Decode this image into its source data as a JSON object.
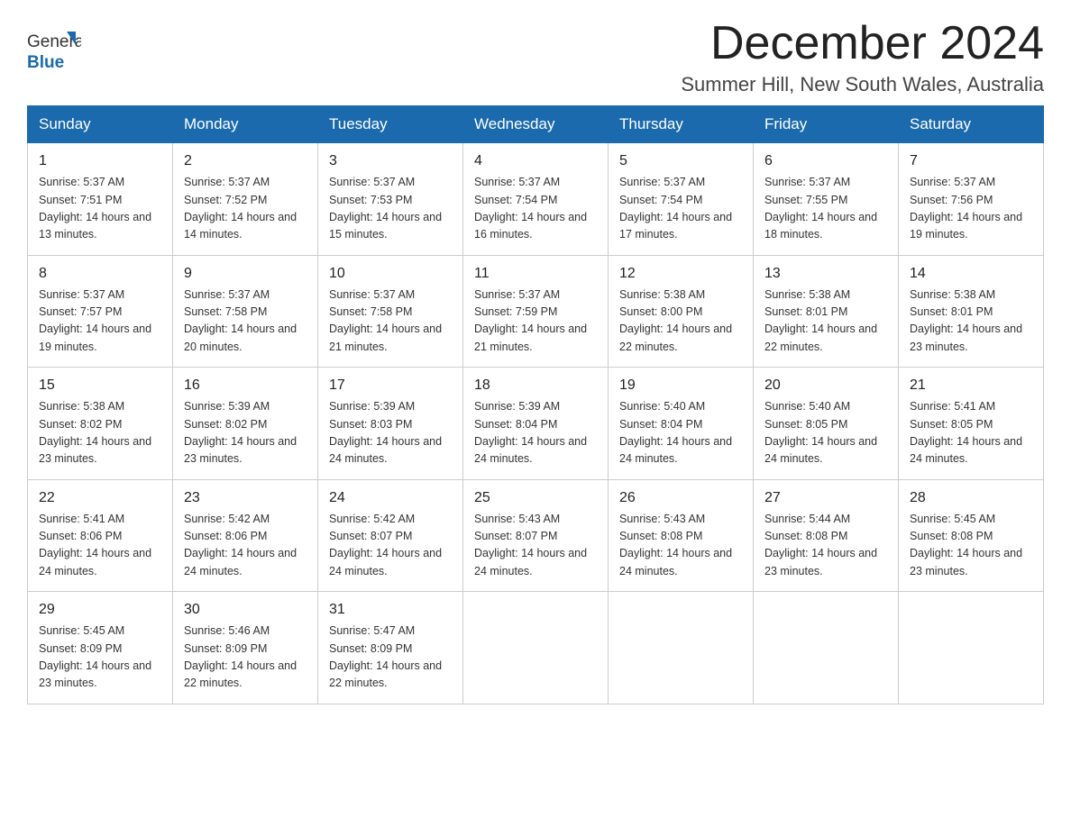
{
  "header": {
    "title": "December 2024",
    "location": "Summer Hill, New South Wales, Australia",
    "logo_general": "General",
    "logo_blue": "Blue"
  },
  "days_of_week": [
    "Sunday",
    "Monday",
    "Tuesday",
    "Wednesday",
    "Thursday",
    "Friday",
    "Saturday"
  ],
  "weeks": [
    [
      {
        "day": "1",
        "sunrise": "Sunrise: 5:37 AM",
        "sunset": "Sunset: 7:51 PM",
        "daylight": "Daylight: 14 hours and 13 minutes."
      },
      {
        "day": "2",
        "sunrise": "Sunrise: 5:37 AM",
        "sunset": "Sunset: 7:52 PM",
        "daylight": "Daylight: 14 hours and 14 minutes."
      },
      {
        "day": "3",
        "sunrise": "Sunrise: 5:37 AM",
        "sunset": "Sunset: 7:53 PM",
        "daylight": "Daylight: 14 hours and 15 minutes."
      },
      {
        "day": "4",
        "sunrise": "Sunrise: 5:37 AM",
        "sunset": "Sunset: 7:54 PM",
        "daylight": "Daylight: 14 hours and 16 minutes."
      },
      {
        "day": "5",
        "sunrise": "Sunrise: 5:37 AM",
        "sunset": "Sunset: 7:54 PM",
        "daylight": "Daylight: 14 hours and 17 minutes."
      },
      {
        "day": "6",
        "sunrise": "Sunrise: 5:37 AM",
        "sunset": "Sunset: 7:55 PM",
        "daylight": "Daylight: 14 hours and 18 minutes."
      },
      {
        "day": "7",
        "sunrise": "Sunrise: 5:37 AM",
        "sunset": "Sunset: 7:56 PM",
        "daylight": "Daylight: 14 hours and 19 minutes."
      }
    ],
    [
      {
        "day": "8",
        "sunrise": "Sunrise: 5:37 AM",
        "sunset": "Sunset: 7:57 PM",
        "daylight": "Daylight: 14 hours and 19 minutes."
      },
      {
        "day": "9",
        "sunrise": "Sunrise: 5:37 AM",
        "sunset": "Sunset: 7:58 PM",
        "daylight": "Daylight: 14 hours and 20 minutes."
      },
      {
        "day": "10",
        "sunrise": "Sunrise: 5:37 AM",
        "sunset": "Sunset: 7:58 PM",
        "daylight": "Daylight: 14 hours and 21 minutes."
      },
      {
        "day": "11",
        "sunrise": "Sunrise: 5:37 AM",
        "sunset": "Sunset: 7:59 PM",
        "daylight": "Daylight: 14 hours and 21 minutes."
      },
      {
        "day": "12",
        "sunrise": "Sunrise: 5:38 AM",
        "sunset": "Sunset: 8:00 PM",
        "daylight": "Daylight: 14 hours and 22 minutes."
      },
      {
        "day": "13",
        "sunrise": "Sunrise: 5:38 AM",
        "sunset": "Sunset: 8:01 PM",
        "daylight": "Daylight: 14 hours and 22 minutes."
      },
      {
        "day": "14",
        "sunrise": "Sunrise: 5:38 AM",
        "sunset": "Sunset: 8:01 PM",
        "daylight": "Daylight: 14 hours and 23 minutes."
      }
    ],
    [
      {
        "day": "15",
        "sunrise": "Sunrise: 5:38 AM",
        "sunset": "Sunset: 8:02 PM",
        "daylight": "Daylight: 14 hours and 23 minutes."
      },
      {
        "day": "16",
        "sunrise": "Sunrise: 5:39 AM",
        "sunset": "Sunset: 8:02 PM",
        "daylight": "Daylight: 14 hours and 23 minutes."
      },
      {
        "day": "17",
        "sunrise": "Sunrise: 5:39 AM",
        "sunset": "Sunset: 8:03 PM",
        "daylight": "Daylight: 14 hours and 24 minutes."
      },
      {
        "day": "18",
        "sunrise": "Sunrise: 5:39 AM",
        "sunset": "Sunset: 8:04 PM",
        "daylight": "Daylight: 14 hours and 24 minutes."
      },
      {
        "day": "19",
        "sunrise": "Sunrise: 5:40 AM",
        "sunset": "Sunset: 8:04 PM",
        "daylight": "Daylight: 14 hours and 24 minutes."
      },
      {
        "day": "20",
        "sunrise": "Sunrise: 5:40 AM",
        "sunset": "Sunset: 8:05 PM",
        "daylight": "Daylight: 14 hours and 24 minutes."
      },
      {
        "day": "21",
        "sunrise": "Sunrise: 5:41 AM",
        "sunset": "Sunset: 8:05 PM",
        "daylight": "Daylight: 14 hours and 24 minutes."
      }
    ],
    [
      {
        "day": "22",
        "sunrise": "Sunrise: 5:41 AM",
        "sunset": "Sunset: 8:06 PM",
        "daylight": "Daylight: 14 hours and 24 minutes."
      },
      {
        "day": "23",
        "sunrise": "Sunrise: 5:42 AM",
        "sunset": "Sunset: 8:06 PM",
        "daylight": "Daylight: 14 hours and 24 minutes."
      },
      {
        "day": "24",
        "sunrise": "Sunrise: 5:42 AM",
        "sunset": "Sunset: 8:07 PM",
        "daylight": "Daylight: 14 hours and 24 minutes."
      },
      {
        "day": "25",
        "sunrise": "Sunrise: 5:43 AM",
        "sunset": "Sunset: 8:07 PM",
        "daylight": "Daylight: 14 hours and 24 minutes."
      },
      {
        "day": "26",
        "sunrise": "Sunrise: 5:43 AM",
        "sunset": "Sunset: 8:08 PM",
        "daylight": "Daylight: 14 hours and 24 minutes."
      },
      {
        "day": "27",
        "sunrise": "Sunrise: 5:44 AM",
        "sunset": "Sunset: 8:08 PM",
        "daylight": "Daylight: 14 hours and 23 minutes."
      },
      {
        "day": "28",
        "sunrise": "Sunrise: 5:45 AM",
        "sunset": "Sunset: 8:08 PM",
        "daylight": "Daylight: 14 hours and 23 minutes."
      }
    ],
    [
      {
        "day": "29",
        "sunrise": "Sunrise: 5:45 AM",
        "sunset": "Sunset: 8:09 PM",
        "daylight": "Daylight: 14 hours and 23 minutes."
      },
      {
        "day": "30",
        "sunrise": "Sunrise: 5:46 AM",
        "sunset": "Sunset: 8:09 PM",
        "daylight": "Daylight: 14 hours and 22 minutes."
      },
      {
        "day": "31",
        "sunrise": "Sunrise: 5:47 AM",
        "sunset": "Sunset: 8:09 PM",
        "daylight": "Daylight: 14 hours and 22 minutes."
      },
      null,
      null,
      null,
      null
    ]
  ]
}
